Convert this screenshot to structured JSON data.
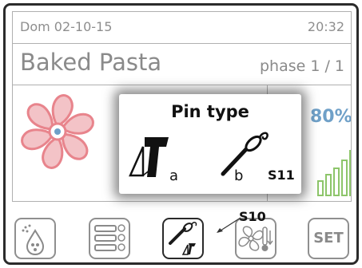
{
  "header": {
    "date": "Dom 02-10-15",
    "time": "20:32"
  },
  "recipe": {
    "name": "Baked Pasta",
    "phase": "phase 1 / 1"
  },
  "status": {
    "fan_speed": "80%"
  },
  "popup": {
    "title": "Pin type",
    "option_a": "a",
    "option_b": "b",
    "code": "S11"
  },
  "callout": {
    "code": "S10"
  },
  "toolbar": {
    "set_label": "SET"
  },
  "colors": {
    "fan": "#e8848c",
    "fan_core": "#6fa0c8",
    "bars": "#8dc56a",
    "percent": "#6fa0c8"
  },
  "icons": {
    "fan": "fan-icon",
    "humidity": "humidity-drop-icon",
    "trays": "tray-timers-icon",
    "probe": "pin-probe-icon",
    "fan_temp": "fan-thermometer-icon"
  }
}
